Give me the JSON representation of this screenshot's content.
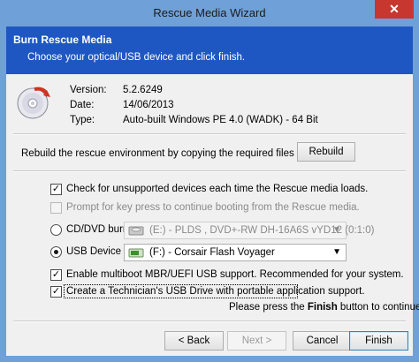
{
  "window": {
    "title": "Rescue Media Wizard",
    "close_glyph": "✕"
  },
  "header": {
    "title": "Burn Rescue Media",
    "subtitle": "Choose your optical/USB device and click finish."
  },
  "info": {
    "icon": "cd-burn-icon",
    "rows": [
      {
        "label": "Version:",
        "value": "5.2.6249"
      },
      {
        "label": "Date:",
        "value": "14/06/2013"
      },
      {
        "label": "Type:",
        "value": "Auto-built Windows PE 4.0 (WADK) - 64 Bit"
      }
    ]
  },
  "rebuild": {
    "text": "Rebuild the rescue environment by copying the required files",
    "button_label": "Rebuild"
  },
  "options": {
    "check_unsupported": {
      "label": "Check for unsupported devices each time the Rescue media loads.",
      "checked": true
    },
    "prompt_key": {
      "label": "Prompt for key press to continue booting from the Rescue media.",
      "checked": false,
      "disabled": true
    },
    "cd_dvd": {
      "label": "CD/DVD burner",
      "selected": false,
      "device": "(E:) - PLDS    , DVD+-RW DH-16A6S vYD12 (0:1:0)"
    },
    "usb": {
      "label": "USB Device",
      "selected": true,
      "device": "(F:) - Corsair Flash Voyager"
    },
    "multiboot": {
      "label": "Enable multiboot MBR/UEFI USB support. Recommended for your system.",
      "checked": true
    },
    "technician": {
      "label": "Create a Technician's USB Drive with portable application support.",
      "checked": true
    }
  },
  "finish_hint": {
    "before": "Please press the ",
    "bold": "Finish",
    "after": " button to continue."
  },
  "footer": {
    "back_label": "< Back",
    "next_label": "Next >",
    "cancel_label": "Cancel",
    "finish_label": "Finish"
  },
  "colors": {
    "titlebar": "#6fa0d8",
    "header": "#1f57c2",
    "close": "#c7372f",
    "usb_icon": "#3f8f2f"
  }
}
